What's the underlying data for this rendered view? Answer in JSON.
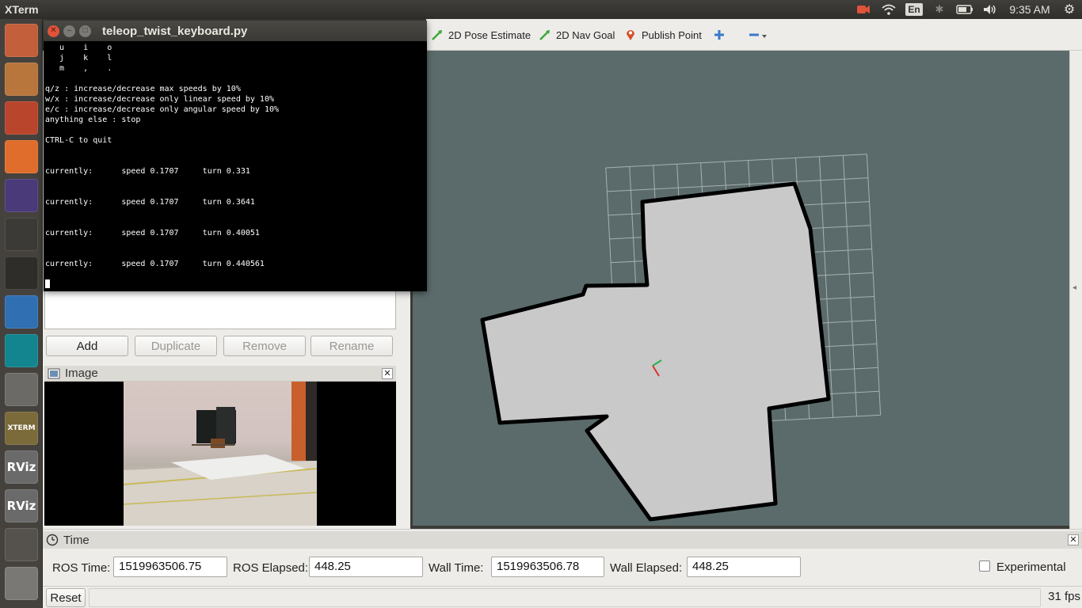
{
  "top_panel": {
    "app_title": "XTerm",
    "lang": "En",
    "clock": "9:35 AM",
    "icons": [
      "camera-icon",
      "wifi-icon",
      "keyboard-lang-icon",
      "bluetooth-icon",
      "battery-icon",
      "volume-icon",
      "gear-icon"
    ]
  },
  "launcher": {
    "items": [
      {
        "name": "ubuntu-dash-icon",
        "color": "#c35f3a"
      },
      {
        "name": "files-icon",
        "color": "#b8763c"
      },
      {
        "name": "system-settings-icon",
        "color": "#b9452c"
      },
      {
        "name": "software-center-icon",
        "color": "#e06d2b"
      },
      {
        "name": "eclipse-icon",
        "color": "#4b3a7a"
      },
      {
        "name": "sublime-text-icon",
        "color": "#3b3a36"
      },
      {
        "name": "terminal-icon",
        "color": "#2e2d2a"
      },
      {
        "name": "chromium-icon",
        "color": "#2f6fb2"
      },
      {
        "name": "arduino-icon",
        "color": "#12858f"
      },
      {
        "name": "text-editor-icon",
        "color": "#6c6a66"
      },
      {
        "name": "xterm-icon",
        "color": "#7b6a3a",
        "label": "XTERM"
      },
      {
        "name": "rviz-icon",
        "color": "#6a6a6a",
        "label": "RViz"
      },
      {
        "name": "rviz-icon-2",
        "color": "#6a6a6a",
        "label": "RViz"
      },
      {
        "name": "workspace-switcher-icon",
        "color": "#55524d"
      },
      {
        "name": "disk-drive-icon",
        "color": "#7a7874"
      }
    ]
  },
  "xterm": {
    "title": "teleop_twist_keyboard.py",
    "lines": [
      "   u    i    o",
      "   j    k    l",
      "   m    ,    .",
      "",
      "q/z : increase/decrease max speeds by 10%",
      "w/x : increase/decrease only linear speed by 10%",
      "e/c : increase/decrease only angular speed by 10%",
      "anything else : stop",
      "",
      "CTRL-C to quit",
      "",
      "",
      "currently:      speed 0.1707     turn 0.331",
      "",
      "",
      "currently:      speed 0.1707     turn 0.3641",
      "",
      "",
      "currently:      speed 0.1707     turn 0.40051",
      "",
      "",
      "currently:      speed 0.1707     turn 0.440561"
    ]
  },
  "toolbar": {
    "pose_estimate": "2D Pose Estimate",
    "nav_goal": "2D Nav Goal",
    "publish_point": "Publish Point"
  },
  "displays": {
    "add": "Add",
    "duplicate": "Duplicate",
    "remove": "Remove",
    "rename": "Rename"
  },
  "image_panel": {
    "title": "Image"
  },
  "time_panel": {
    "title": "Time",
    "ros_time_label": "ROS Time:",
    "ros_time": "1519963506.75",
    "ros_elapsed_label": "ROS Elapsed:",
    "ros_elapsed": "448.25",
    "wall_time_label": "Wall Time:",
    "wall_time": "1519963506.78",
    "wall_elapsed_label": "Wall Elapsed:",
    "wall_elapsed": "448.25",
    "experimental_label": "Experimental",
    "experimental_checked": false
  },
  "status_bar": {
    "reset": "Reset",
    "fps": "31 fps"
  },
  "colors": {
    "panel_bg": "#edece9",
    "render_bg": "#5b6b6b",
    "map_free": "#c9c9c9",
    "map_wall": "#000000",
    "grid": "#a8b0b0",
    "close_button": "#e0533b"
  }
}
